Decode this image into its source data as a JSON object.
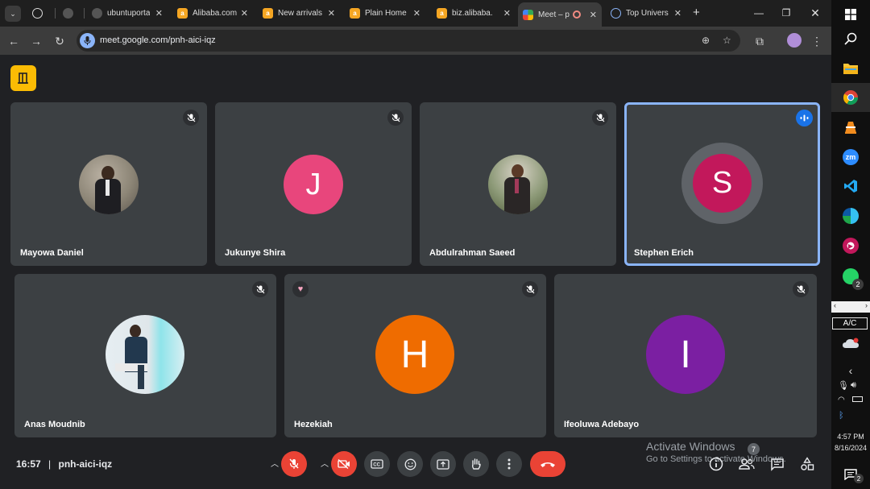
{
  "browser": {
    "tabs": [
      {
        "label": "",
        "icon": "openai-icon"
      },
      {
        "label": "",
        "icon": "github-icon"
      },
      {
        "label": "ubuntuporta",
        "icon": "github-icon"
      },
      {
        "label": "Alibaba.com",
        "icon": "alibaba-icon"
      },
      {
        "label": "New arrivals",
        "icon": "alibaba-icon"
      },
      {
        "label": "Plain Home",
        "icon": "alibaba-icon"
      },
      {
        "label": "biz.alibaba.c",
        "icon": "alibaba-icon"
      },
      {
        "label": "Meet – p",
        "icon": "meet-icon"
      },
      {
        "label": "Top Univers",
        "icon": "globe-icon"
      }
    ],
    "new_tab": "+",
    "url": "meet.google.com/pnh-aici-iqz"
  },
  "meet": {
    "participants": [
      {
        "name": "Mayowa Daniel",
        "avatar": "photo",
        "muted": true
      },
      {
        "name": "Jukunye Shira",
        "initial": "J",
        "color": "#e8467c",
        "muted": true
      },
      {
        "name": "Abdulrahman Saeed",
        "avatar": "photo",
        "muted": true
      },
      {
        "name": "Stephen Erich",
        "initial": "S",
        "color": "#c2185b",
        "muted": false,
        "speaking": true
      },
      {
        "name": "Anas Moudnib",
        "avatar": "photo",
        "muted": true
      },
      {
        "name": "Hezekiah",
        "initial": "H",
        "color": "#ef6c00",
        "muted": true,
        "reaction": "heart"
      },
      {
        "name": "Ifeoluwa Adebayo",
        "initial": "I",
        "color": "#7b1fa2",
        "muted": true
      }
    ],
    "time": "16:57",
    "separator": "|",
    "meeting_code": "pnh-aici-iqz",
    "people_count": "7",
    "watermark": {
      "line1": "Activate Windows",
      "line2": "Go to Settings to activate Windows."
    }
  },
  "taskbar": {
    "whatsapp_badge": "2",
    "ac_label": "A/C",
    "time": "4:57 PM",
    "date": "8/16/2024",
    "notification_count": "2"
  }
}
